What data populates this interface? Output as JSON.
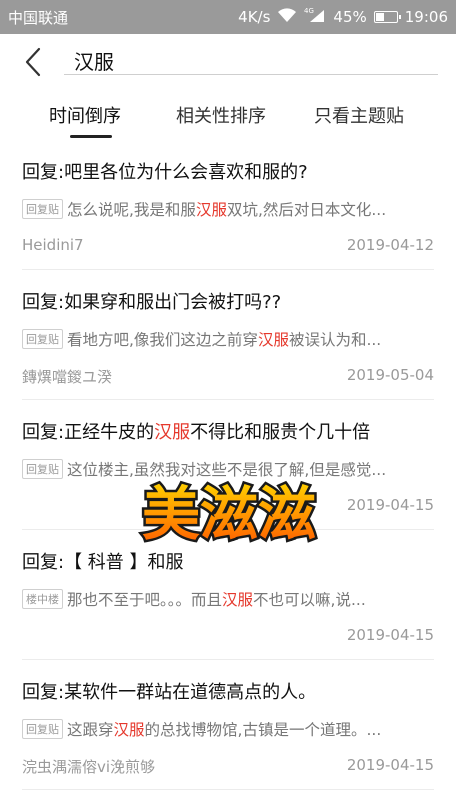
{
  "status_bar": {
    "carrier": "中国联通",
    "speed": "4K/s",
    "network": "4G",
    "battery_percent": "45%",
    "battery_level": 0.45,
    "time": "19:06"
  },
  "search": {
    "query": "汉服",
    "back_icon": "chevron-left-icon"
  },
  "tabs": [
    {
      "label": "时间倒序",
      "active": true
    },
    {
      "label": "相关性排序",
      "active": false
    },
    {
      "label": "只看主题贴",
      "active": false
    }
  ],
  "results": [
    {
      "title_parts": [
        "回复:吧里各位为什么会喜欢和服的?"
      ],
      "badge": "回复贴",
      "snippet_parts": [
        "怎么说呢,我是和服",
        "汉服",
        "双坑,然后对日本文化..."
      ],
      "author": "Heidini7",
      "date": "2019-04-12"
    },
    {
      "title_parts": [
        "回复:如果穿和服出门会被打吗??"
      ],
      "badge": "回复贴",
      "snippet_parts": [
        "看地方吧,像我们这边之前穿",
        "汉服",
        "被误认为和..."
      ],
      "author": "鏄熼噹鍐ユ湀",
      "date": "2019-05-04"
    },
    {
      "title_parts": [
        "回复:正经牛皮的",
        "汉服",
        "不得比和服贵个几十倍"
      ],
      "badge": "回复贴",
      "snippet_parts": [
        "这位楼主,虽然我对这些不是很了解,但是感觉..."
      ],
      "author": "",
      "date": "2019-04-15"
    },
    {
      "title_parts": [
        "回复:【 科普 】和服"
      ],
      "badge": "楼中楼",
      "snippet_parts": [
        "那也不至于吧。。。而且",
        "汉服",
        "不也可以嘛,说..."
      ],
      "author": "",
      "date": "2019-04-15"
    },
    {
      "title_parts": [
        "回复:某软件一群站在道德高点的人。"
      ],
      "badge": "回复贴",
      "snippet_parts": [
        "这跟穿",
        "汉服",
        "的总找博物馆,古镇是一个道理。..."
      ],
      "author": "浣虫湡濡傛vi浼煎够",
      "date": "2019-04-15"
    }
  ],
  "watermark": "美滋滋",
  "colors": {
    "status_bar_bg": "#9a9a9a",
    "highlight": "#e5382c",
    "watermark_fill": "#ff8a00",
    "watermark_stroke": "#1a1a1a"
  }
}
